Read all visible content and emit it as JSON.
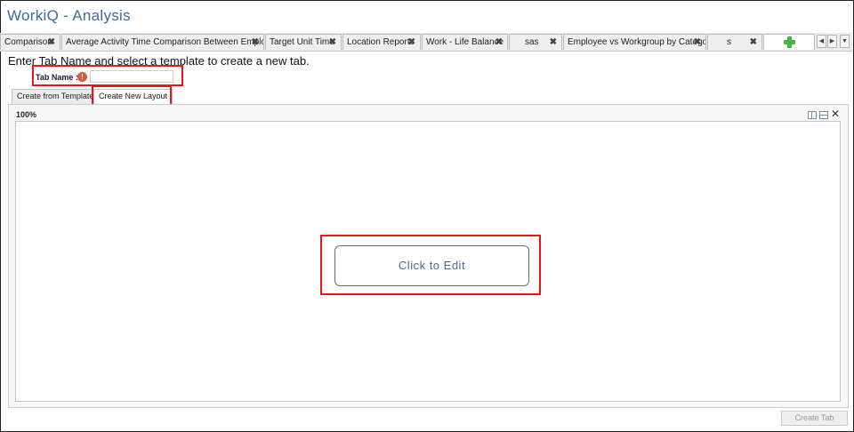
{
  "app": {
    "title": "WorkiQ - Analysis"
  },
  "report_tabs": [
    {
      "label": "Comparison",
      "close": "✖"
    },
    {
      "label": "Average Activity Time Comparison Between Employees",
      "close": "✖"
    },
    {
      "label": "Target Unit Time",
      "close": "✖"
    },
    {
      "label": "Location Reports",
      "close": "✖"
    },
    {
      "label": "Work - Life Balance",
      "close": "✖"
    },
    {
      "label": "sas",
      "close": "✖"
    },
    {
      "label": "Employee vs Workgroup by Category",
      "close": "✖"
    },
    {
      "label": "s",
      "close": "✖"
    }
  ],
  "tab_nav": {
    "prev": "◀",
    "next": "▶",
    "menu": "▼"
  },
  "instructions": "Enter Tab Name and select a template to create a new tab.",
  "tab_name": {
    "label": "Tab Name :",
    "info": "!",
    "value": "",
    "placeholder": ""
  },
  "subtabs": [
    {
      "label": "Create from Template",
      "active": false
    },
    {
      "label": "Create New Layout",
      "active": true
    }
  ],
  "layout_panel": {
    "zoom": "100%",
    "close": "✕"
  },
  "canvas": {
    "edit_label": "Click to Edit"
  },
  "footer": {
    "create_label": "Create Tab"
  },
  "icons": {
    "add_tab": "plus-icon",
    "info": "alert-icon"
  },
  "colors": {
    "title": "#3f6a9a",
    "highlight": "#e8161b",
    "add": "#3fb83f",
    "alert": "#e0533a",
    "edit_border": "#5c6f85"
  }
}
